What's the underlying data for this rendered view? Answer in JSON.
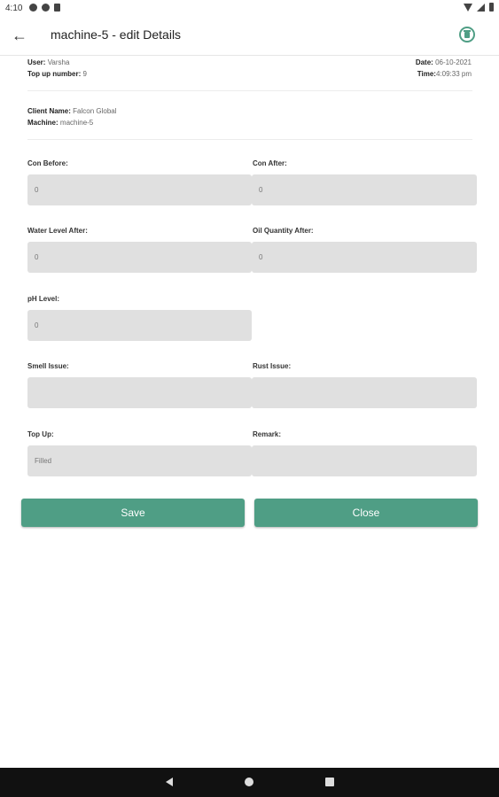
{
  "status_bar": {
    "time": "4:10"
  },
  "app_bar": {
    "back_icon": "arrow-left-icon",
    "title": "machine-5 - edit Details",
    "delete_icon": "delete-icon"
  },
  "header": {
    "user_label": "User:",
    "user_value": "Varsha",
    "topup_label": "Top up number:",
    "topup_value": "9",
    "date_label": "Date:",
    "date_value": "06-10-2021",
    "time_label": "Time:",
    "time_value": "4:09:33 pm"
  },
  "client": {
    "client_label": "Client Name:",
    "client_value": "Falcon Global",
    "machine_label": "Machine:",
    "machine_value": "machine-5"
  },
  "fields": {
    "con_before": {
      "label": "Con Before:",
      "value": "0"
    },
    "con_after": {
      "label": "Con After:",
      "value": "0"
    },
    "water_level_after": {
      "label": "Water Level After:",
      "value": "0"
    },
    "oil_quantity_after": {
      "label": "Oil Quantity After:",
      "value": "0"
    },
    "ph_level": {
      "label": "pH Level:",
      "value": "0"
    },
    "smell_issue": {
      "label": "Smell Issue:",
      "value": ""
    },
    "rust_issue": {
      "label": "Rust Issue:",
      "value": ""
    },
    "top_up": {
      "label": "Top Up:",
      "value": "Filled"
    },
    "remark": {
      "label": "Remark:",
      "value": ""
    }
  },
  "actions": {
    "save_label": "Save",
    "close_label": "Close"
  },
  "colors": {
    "accent": "#4f9e85",
    "field_bg": "#e0e0e0"
  }
}
